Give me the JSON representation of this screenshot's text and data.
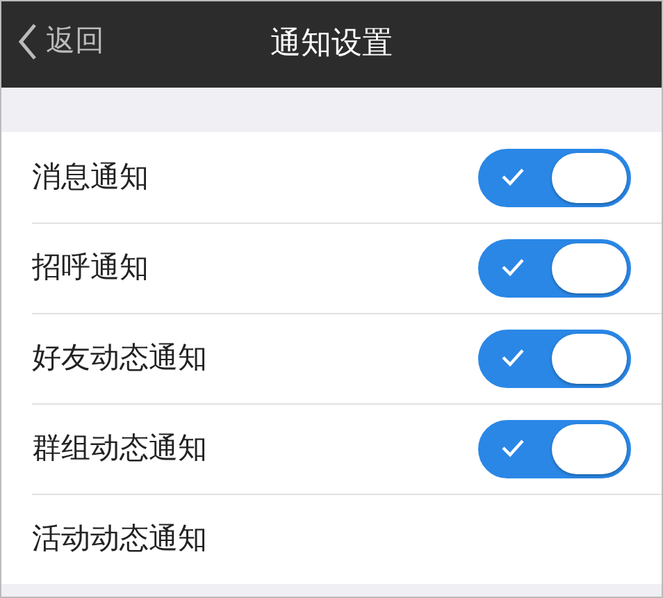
{
  "header": {
    "back": "返回",
    "title": "通知设置"
  },
  "items": [
    {
      "label": "消息通知",
      "kind": "toggle",
      "on": true
    },
    {
      "label": "招呼通知",
      "kind": "toggle",
      "on": true
    },
    {
      "label": "好友动态通知",
      "kind": "toggle",
      "on": true
    },
    {
      "label": "群组动态通知",
      "kind": "toggle",
      "on": true
    },
    {
      "label": "活动动态通知",
      "kind": "text"
    }
  ]
}
